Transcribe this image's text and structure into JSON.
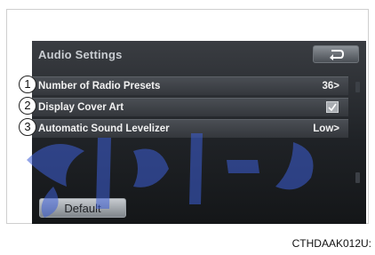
{
  "screen": {
    "title": "Audio Settings",
    "back_icon": "back-arrow-icon",
    "rows": [
      {
        "callout": "1",
        "label": "Number of Radio Presets",
        "value": "36>"
      },
      {
        "callout": "2",
        "label": "Display Cover Art",
        "checked": true
      },
      {
        "callout": "3",
        "label": "Automatic Sound Levelizer",
        "value": "Low>"
      }
    ],
    "default_button": "Default"
  },
  "caption": "CTHDAAK012U:"
}
